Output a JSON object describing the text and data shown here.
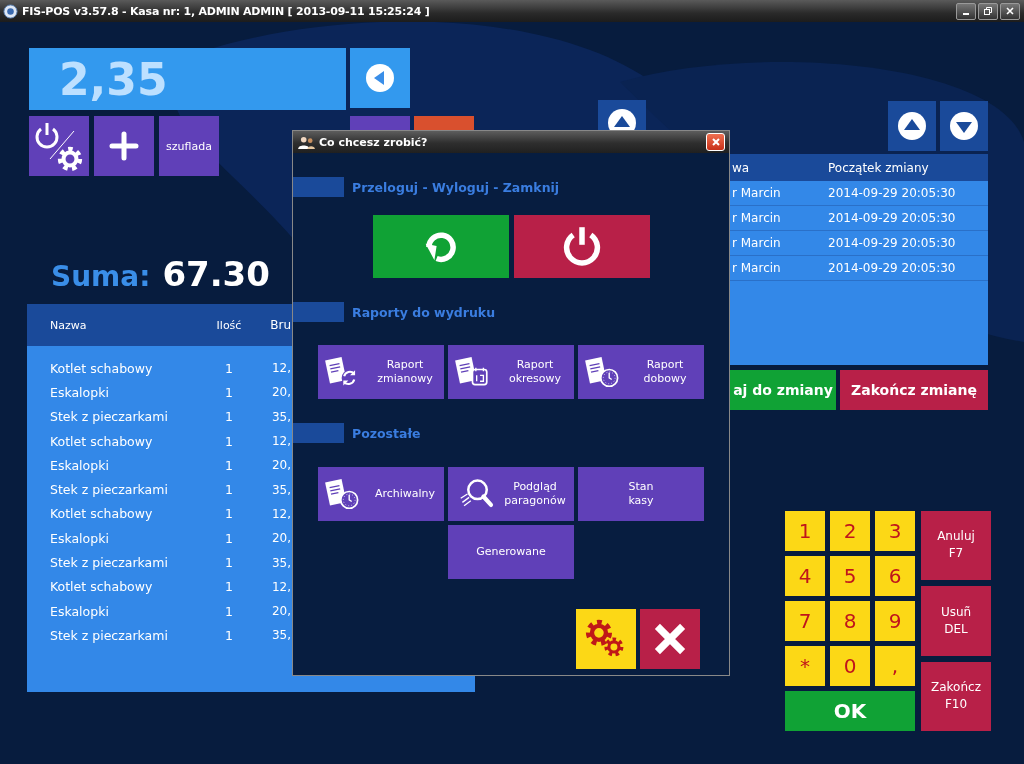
{
  "window": {
    "title": "FIS-POS v3.57.8 - Kasa nr: 1, ADMIN ADMIN [ 2013-09-11 15:25:24 ]"
  },
  "display": {
    "value": "2,35"
  },
  "tiles": [
    {
      "kind": "power-settings"
    },
    {
      "kind": "plus"
    },
    {
      "kind": "text",
      "label": "szuflada"
    }
  ],
  "partial_tiles": [
    {
      "color": "#6040b8"
    },
    {
      "color": "#d9502e"
    }
  ],
  "total": {
    "label": "Suma:",
    "value": "67.30"
  },
  "order_table": {
    "columns": [
      "Nazwa",
      "Ilość",
      "Bru"
    ],
    "rows": [
      [
        "Kotlet schabowy",
        "1",
        "12,"
      ],
      [
        "Eskalopki",
        "1",
        "20,"
      ],
      [
        "Stek z pieczarkami",
        "1",
        "35,"
      ],
      [
        "Kotlet schabowy",
        "1",
        "12,"
      ],
      [
        "Eskalopki",
        "1",
        "20,"
      ],
      [
        "Stek z pieczarkami",
        "1",
        "35,"
      ],
      [
        "Kotlet schabowy",
        "1",
        "12,"
      ],
      [
        "Eskalopki",
        "1",
        "20,"
      ],
      [
        "Stek z pieczarkami",
        "1",
        "35,"
      ],
      [
        "Kotlet schabowy",
        "1",
        "12,"
      ],
      [
        "Eskalopki",
        "1",
        "20,"
      ],
      [
        "Stek z pieczarkami",
        "1",
        "35,"
      ]
    ]
  },
  "shift_table": {
    "columns": [
      "wa",
      "Początek zmiany"
    ],
    "rows": [
      [
        "r Marcin",
        "2014-09-29 20:05:30"
      ],
      [
        "r Marcin",
        "2014-09-29 20:05:30"
      ],
      [
        "r Marcin",
        "2014-09-29 20:05:30"
      ],
      [
        "r Marcin",
        "2014-09-29 20:05:30"
      ]
    ]
  },
  "shift_buttons": [
    {
      "label": "aj do zmiany",
      "color": "#10a235"
    },
    {
      "label": "Zakończ zmianę",
      "color": "#b82048"
    }
  ],
  "keypad": {
    "keys": [
      "1",
      "2",
      "3",
      "4",
      "5",
      "6",
      "7",
      "8",
      "9",
      "*",
      "0",
      ","
    ],
    "ok": "OK",
    "actions": [
      [
        "Anuluj",
        "F7"
      ],
      [
        "Usuñ",
        "DEL"
      ],
      [
        "Zakończ",
        "F10"
      ]
    ]
  },
  "dialog": {
    "title": "Co chcesz zrobić?",
    "sections": [
      {
        "title": "Przeloguj - Wyloguj - Zamknij",
        "buttons": [
          {
            "kind": "relogin"
          },
          {
            "kind": "power"
          }
        ]
      },
      {
        "title": "Raporty do wydruku",
        "buttons": [
          {
            "kind": "report",
            "lines": [
              "Raport",
              "zmianowy"
            ]
          },
          {
            "kind": "report",
            "lines": [
              "Raport",
              "okresowy"
            ]
          },
          {
            "kind": "report",
            "lines": [
              "Raport",
              "dobowy"
            ]
          }
        ]
      },
      {
        "title": "Pozostałe",
        "buttons": [
          {
            "kind": "report",
            "lines": [
              "Archiwalny"
            ]
          },
          {
            "kind": "report",
            "lines": [
              "Podgląd",
              "paragonów"
            ]
          },
          {
            "kind": "report",
            "lines": [
              "Stan",
              "kasy"
            ]
          },
          {
            "kind": "report",
            "lines": [
              "Generowane"
            ]
          }
        ]
      }
    ],
    "footer": [
      {
        "kind": "settings"
      },
      {
        "kind": "close"
      }
    ]
  }
}
